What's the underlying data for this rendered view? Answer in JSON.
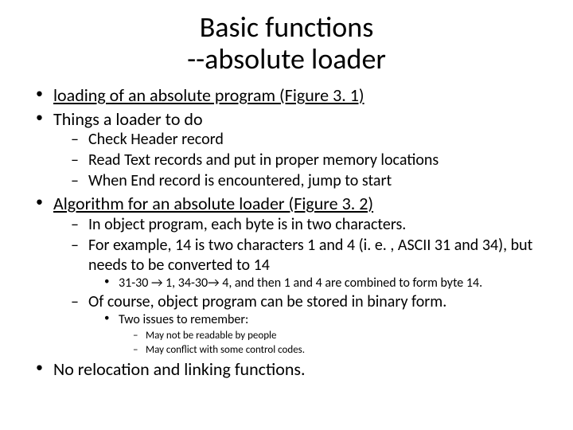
{
  "title_line1": "Basic functions",
  "title_line2": "--absolute loader",
  "b1": "loading of an absolute program (Figure 3. 1)",
  "b2": "Things a loader to do",
  "b2_1": "Check Header record",
  "b2_2": "Read Text records and put in proper memory locations",
  "b2_3": "When End record is encountered, jump to start",
  "b3": "Algorithm for an absolute loader (Figure 3. 2)",
  "b3_1": "In object program, each byte is in two characters.",
  "b3_2": "For example, 14 is two characters 1 and 4 (i. e. , ASCII 31 and 34), but needs to be converted to 14",
  "b3_2_1": "31-30 → 1, 34-30→ 4, and then 1 and 4 are combined to form byte 14.",
  "b3_3": "Of course, object program can be stored in binary form.",
  "b3_3_1": "Two issues to remember:",
  "b3_3_1_1": "May not be readable by people",
  "b3_3_1_2": "May conflict with some control codes.",
  "b4": "No relocation and linking functions."
}
